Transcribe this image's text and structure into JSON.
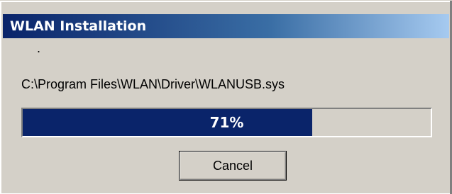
{
  "window": {
    "title": "WLAN Installation",
    "status_dot": "."
  },
  "file_path": "C:\\Program Files\\WLAN\\Driver\\WLANUSB.sys",
  "progress": {
    "percent": 71,
    "label": "71%"
  },
  "buttons": {
    "cancel_label": "Cancel"
  },
  "colors": {
    "titlebar_start": "#0a246a",
    "titlebar_end": "#a6caf0",
    "progress_fill": "#0a246a",
    "face": "#d4d0c8"
  }
}
